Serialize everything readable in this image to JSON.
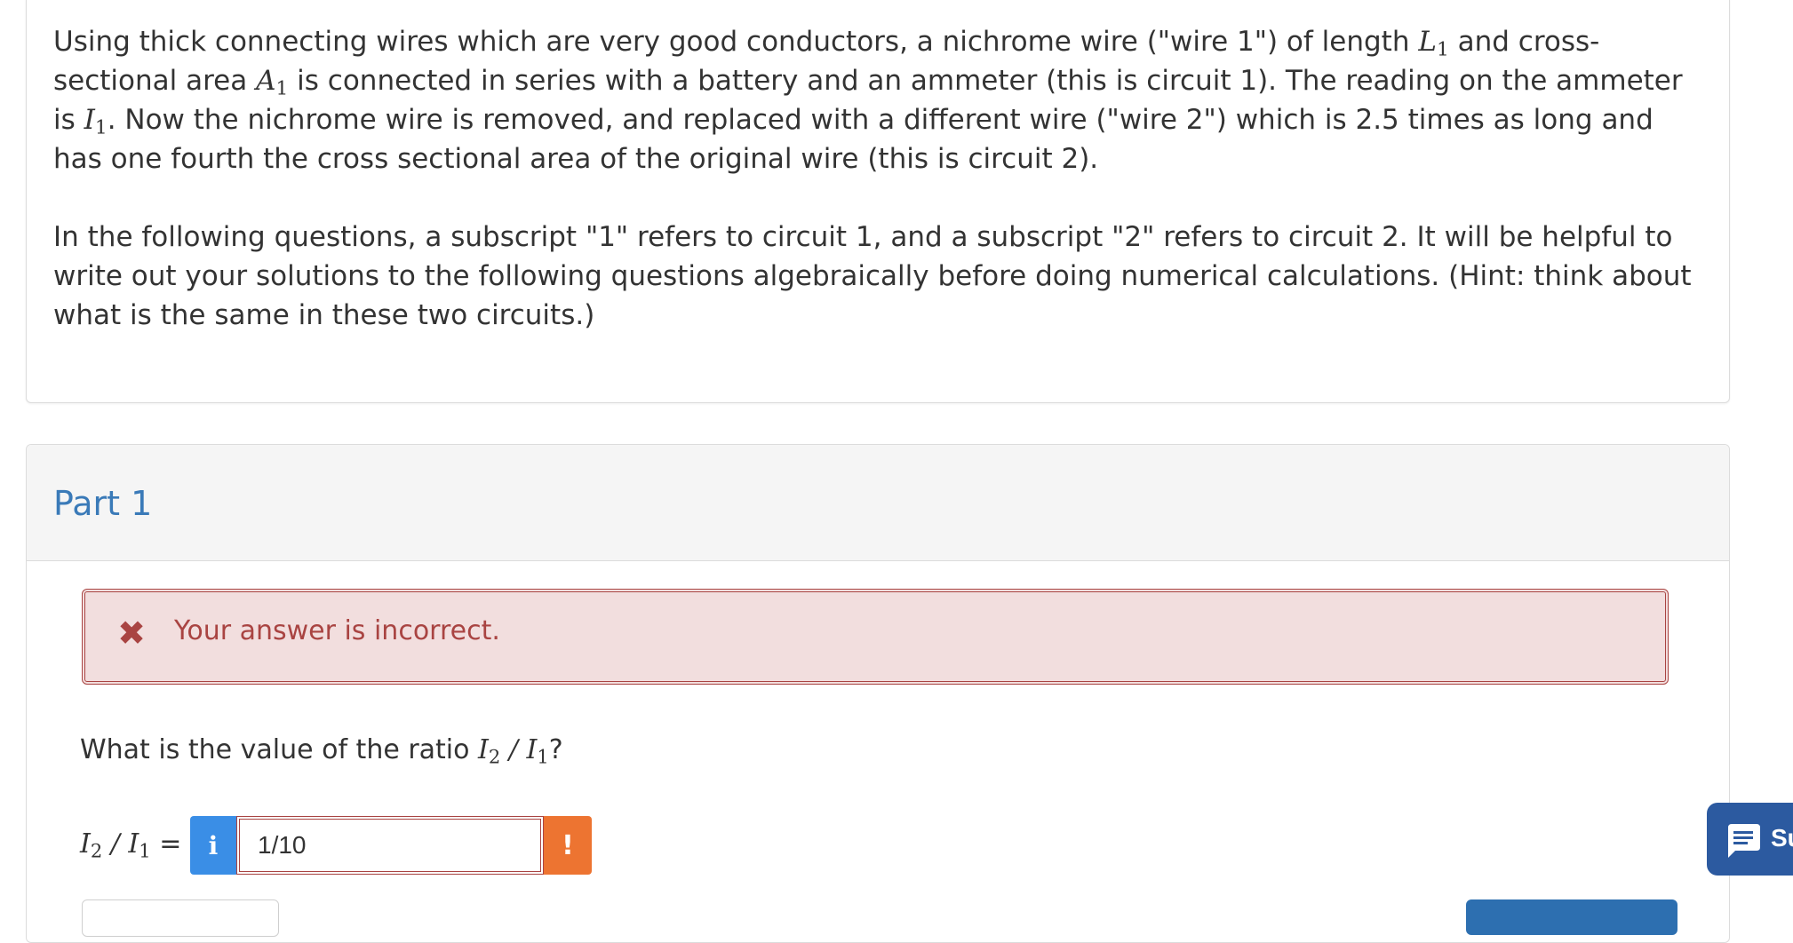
{
  "stem": {
    "p1": {
      "t1": "Using thick connecting wires which are very good conductors, a nichrome wire (\"wire 1\") of length ",
      "v1": "L",
      "s1": "1",
      "t2": " and cross-sectional area ",
      "v2": "A",
      "s2": "1",
      "t3": " is connected in series with a battery and an ammeter (this is circuit 1). The reading on the ammeter is ",
      "v3": "I",
      "s3": "1",
      "t4": ". Now the nichrome wire is removed, and replaced with a different wire (\"wire 2\") which is 2.5 times as long and has one fourth the cross sectional area of the original wire (this is circuit 2)."
    },
    "p2": "In the following questions, a subscript \"1\" refers to circuit 1, and a subscript \"2\" refers to circuit 2. It will be helpful to write out your solutions to the following questions algebraically before doing numerical calculations. (Hint: think about what is the same in these two circuits.)"
  },
  "part": {
    "title": "Part 1",
    "alert_icon": "x-icon",
    "alert_text": "Your answer is incorrect.",
    "prompt": {
      "t1": "What is the value of the ratio ",
      "v1": "I",
      "s1": "2",
      "sep": " / ",
      "v2": "I",
      "s2": "1",
      "t2": "?"
    },
    "answer": {
      "label_v1": "I",
      "label_s1": "2",
      "label_sep": " / ",
      "label_v2": "I",
      "label_s2": "1",
      "label_eq": " = ",
      "info_icon": "i",
      "value": "1/10",
      "warn_icon": "!"
    }
  },
  "support": {
    "label": "Su"
  },
  "colors": {
    "link_blue": "#3a7ab8",
    "error_red": "#a94442",
    "error_bg": "#f2dede",
    "info_blue": "#3a8ee6",
    "warn_orange": "#ed7431",
    "support_blue": "#2c5aa0"
  }
}
